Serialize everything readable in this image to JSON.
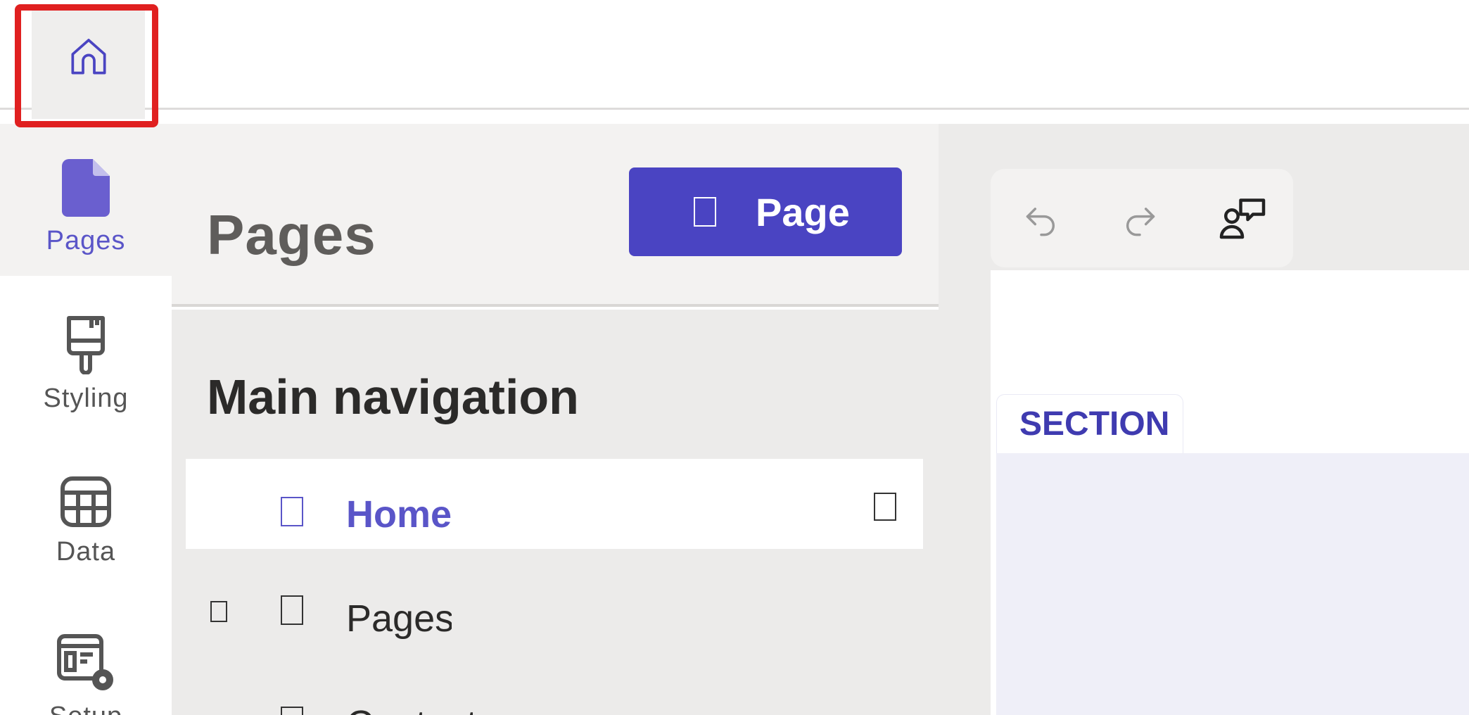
{
  "topbar": {
    "home_icon": "home-icon"
  },
  "rail": {
    "items": [
      {
        "label": "Pages",
        "icon": "page-icon",
        "active": true
      },
      {
        "label": "Styling",
        "icon": "paintbrush-icon",
        "active": false
      },
      {
        "label": "Data",
        "icon": "table-icon",
        "active": false
      },
      {
        "label": "Setup",
        "icon": "settings-window-icon",
        "active": false
      }
    ]
  },
  "panel": {
    "title": "Pages",
    "add_button_label": "Page",
    "section_title": "Main navigation",
    "nav_items": [
      {
        "label": "Home",
        "selected": true
      },
      {
        "label": "Pages",
        "selected": false
      },
      {
        "label": "Contact",
        "selected": false
      }
    ]
  },
  "editor": {
    "toolbar": {
      "undo_icon": "undo-icon",
      "redo_icon": "redo-icon",
      "comments_icon": "comments-icon"
    },
    "section_tag": "SECTION"
  },
  "colors": {
    "accent": "#4a44c2",
    "highlight": "#e02020",
    "active_text": "#5a55c8"
  }
}
